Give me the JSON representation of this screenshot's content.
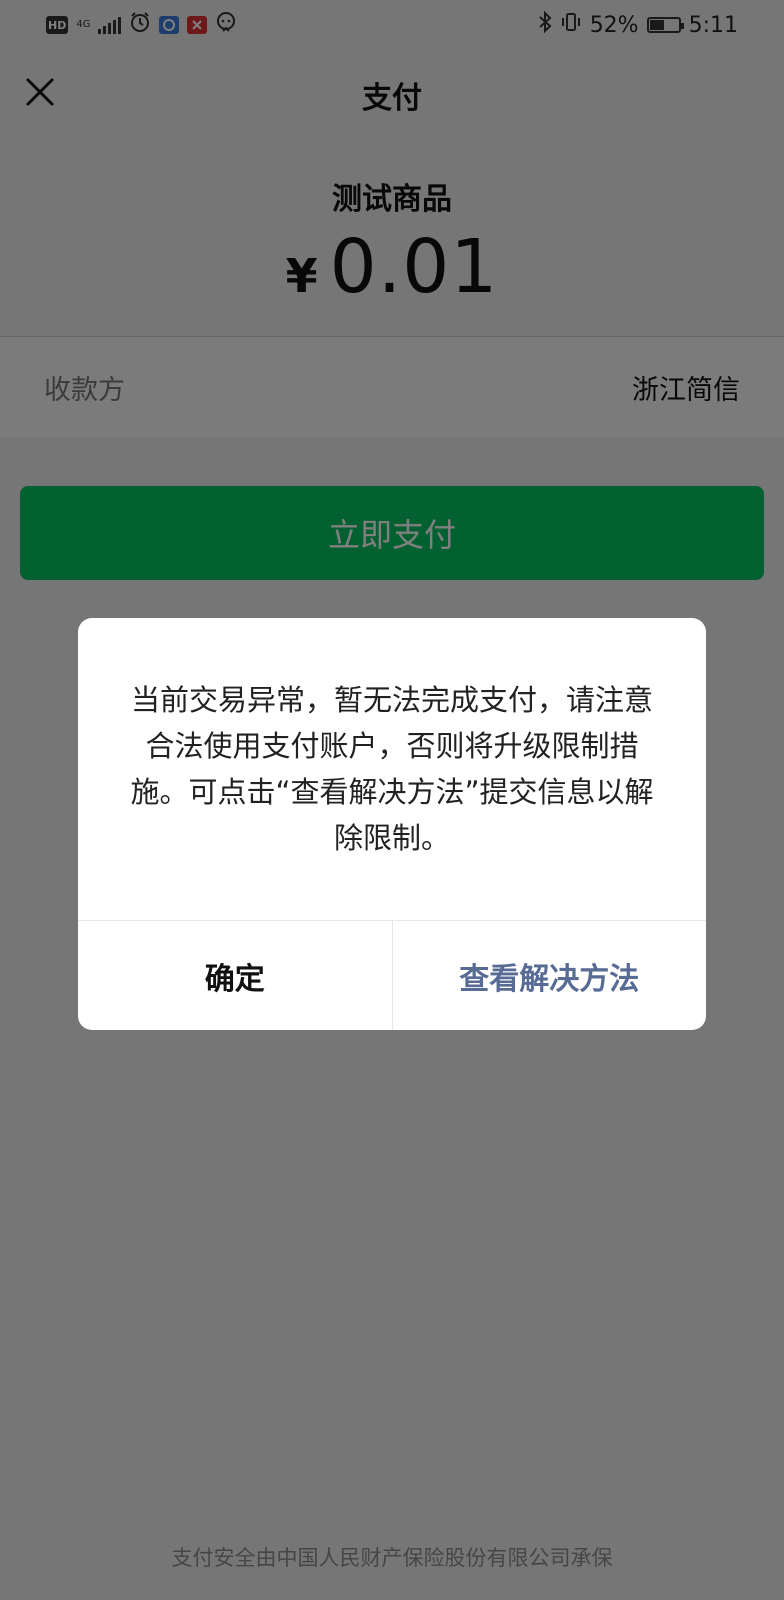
{
  "status_bar": {
    "hd_badge": "HD",
    "network_label": "4G",
    "battery_text": "52%",
    "time": "5:11",
    "battery_level": 0.52
  },
  "nav": {
    "title": "支付",
    "close_icon": "close-icon"
  },
  "product": {
    "name": "测试商品",
    "currency": "¥",
    "amount": "0.01"
  },
  "payee": {
    "label": "收款方",
    "value": "浙江简信"
  },
  "pay_button": {
    "label": "立即支付",
    "color": "#07c160"
  },
  "footer": {
    "text": "支付安全由中国人民财产保险股份有限公司承保"
  },
  "dialog": {
    "message": "当前交易异常，暂无法完成支付，请注意合法使用支付账户，否则将升级限制措施。可点击“查看解决方法”提交信息以解除限制。",
    "confirm_label": "确定",
    "solution_label": "查看解决方法",
    "link_color": "#576b95"
  }
}
